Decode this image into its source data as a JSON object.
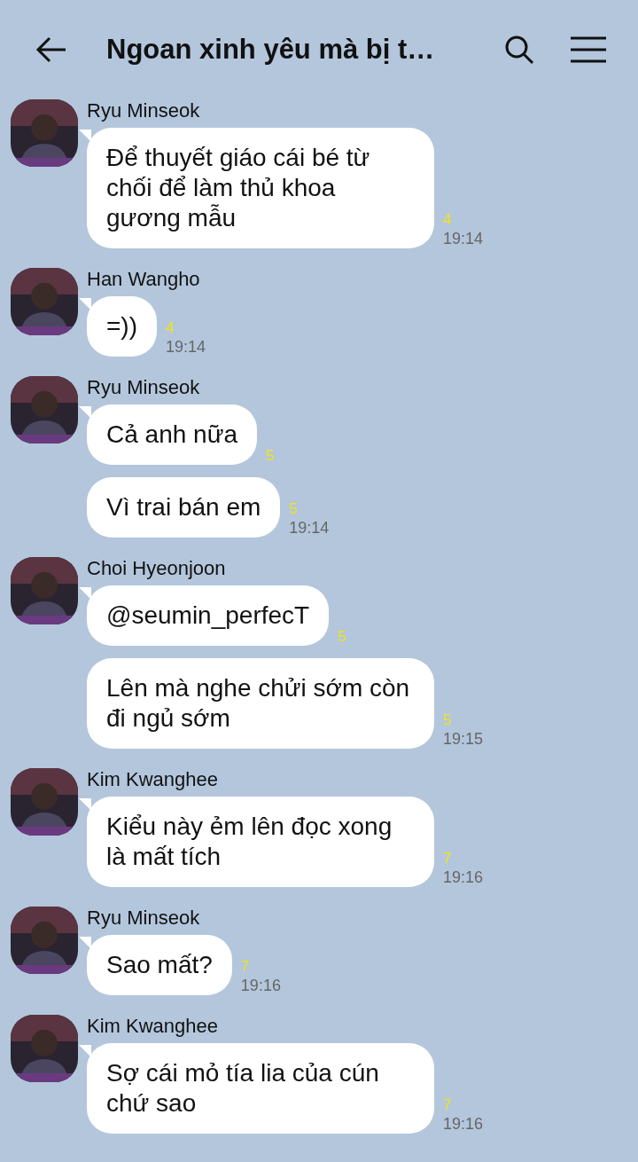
{
  "header": {
    "title": "Ngoan xinh yêu mà bị t…"
  },
  "groups": [
    {
      "sender": "Ryu Minseok",
      "messages": [
        {
          "text": "Để thuyết giáo cái bé từ chối để làm thủ khoa gương mẫu",
          "read": "4",
          "time": "19:14"
        }
      ]
    },
    {
      "sender": "Han Wangho",
      "messages": [
        {
          "text": "=))",
          "read": "4",
          "time": "19:14"
        }
      ]
    },
    {
      "sender": "Ryu Minseok",
      "messages": [
        {
          "text": "Cả anh nữa",
          "read": "5"
        },
        {
          "text": "Vì trai bán em",
          "read": "5",
          "time": "19:14"
        }
      ]
    },
    {
      "sender": "Choi Hyeonjoon",
      "messages": [
        {
          "text": "@seumin_perfecT",
          "read": "5"
        },
        {
          "text": "Lên mà nghe chửi sớm còn đi ngủ sớm",
          "read": "5",
          "time": "19:15"
        }
      ]
    },
    {
      "sender": "Kim Kwanghee",
      "messages": [
        {
          "text": "Kiểu này ẻm lên đọc xong là mất tích",
          "read": "7",
          "time": "19:16"
        }
      ]
    },
    {
      "sender": "Ryu Minseok",
      "messages": [
        {
          "text": "Sao mất?",
          "read": "7",
          "time": "19:16"
        }
      ]
    },
    {
      "sender": "Kim Kwanghee",
      "messages": [
        {
          "text": "Sợ cái mỏ tía lia của cún chứ sao",
          "read": "7",
          "time": "19:16"
        }
      ]
    }
  ]
}
